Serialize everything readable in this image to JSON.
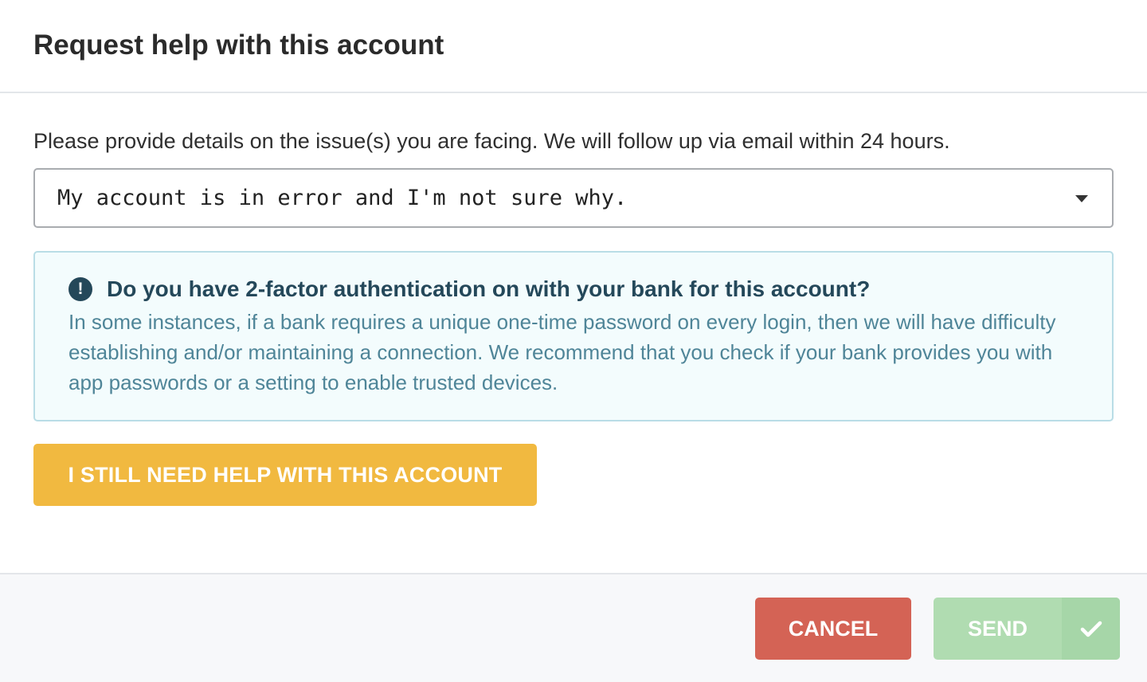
{
  "modal": {
    "title": "Request help with this account"
  },
  "body": {
    "intro": "Please provide details on the issue(s) you are facing. We will follow up via email within 24 hours.",
    "issue_select": {
      "selected": "My account is in error and I'm not sure why."
    },
    "notice": {
      "icon": "exclamation-circle-icon",
      "title": "Do you have 2-factor authentication on with your bank for this account?",
      "text": "In some instances, if a bank requires a unique one-time password on every login, then we will have difficulty establishing and/or maintaining a connection. We recommend that you check if your bank provides you with app passwords or a setting to enable trusted devices."
    },
    "help_button_label": "I STILL NEED HELP WITH THIS ACCOUNT"
  },
  "footer": {
    "cancel_label": "CANCEL",
    "send_label": "SEND",
    "send_icon": "checkmark-icon"
  },
  "colors": {
    "help_button": "#f1b940",
    "cancel_button": "#d46355",
    "send_button_disabled": "#b0dcb1",
    "notice_border": "#b9dde6",
    "notice_background": "#f3fcfd",
    "notice_title": "#24485a",
    "notice_text": "#4f8598"
  }
}
